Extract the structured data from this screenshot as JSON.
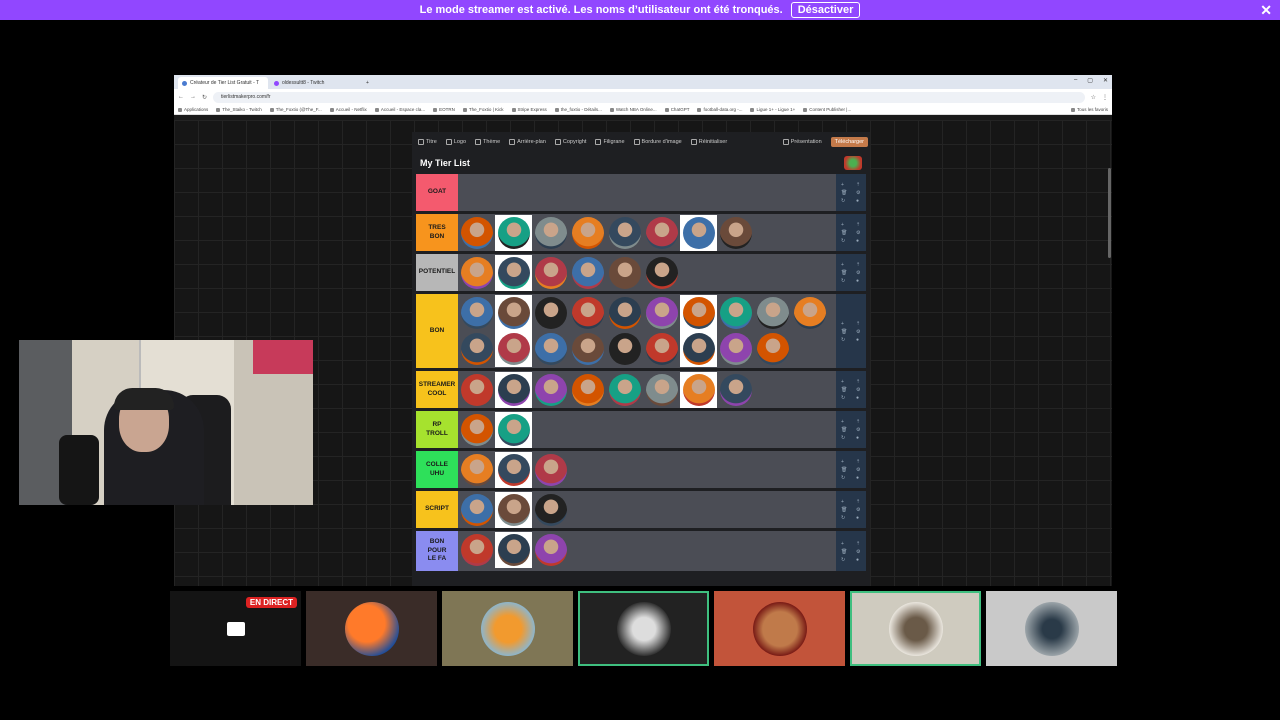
{
  "banner": {
    "text": "Le mode streamer est activé. Les noms d’utilisateur ont été tronqués.",
    "button": "Désactiver",
    "close": "✕"
  },
  "browser": {
    "tabs": [
      "Créateur de Tier List Gratuit - T",
      "oldessultt8 - Twitch"
    ],
    "new_tab": "+",
    "window_controls": [
      "–",
      "▢",
      "✕"
    ],
    "url": "tierlistmakerpro.com/fr",
    "bookmarks": [
      "Applications",
      "The_Staiko - Twitch",
      "The_Foxtio (@The_F...",
      "Accueil - Netflix",
      "Accueil - Espace cla...",
      "EOTRN",
      "The_Foxtio | Kick",
      "Stripe Express",
      "the_foxtio - Détails...",
      "Watch NBA Online...",
      "ChatGPT",
      "football-data.org -...",
      "Ligue 1+ - Ligue 1+",
      "Content Publisher |..."
    ],
    "bookmarks_right": "Tous les favoris"
  },
  "app": {
    "toolbar": [
      "Titre",
      "Logo",
      "Thème",
      "Arrière-plan",
      "Copyright",
      "Filigrane",
      "Bordure d'image",
      "Réinitialiser"
    ],
    "presentation": "Présentation",
    "download": "Télécharger",
    "title": "My Tier List",
    "tiers": [
      {
        "label": "GOAT",
        "color": "#f45a6e",
        "count": 0
      },
      {
        "label": "TRES\nBON",
        "color": "#f7941d",
        "count": 8
      },
      {
        "label": "POTENTIEL",
        "color": "#b7b7b7",
        "count": 6
      },
      {
        "label": "BON",
        "color": "#f7c21c",
        "count": 19
      },
      {
        "label": "STREAMER\nCOOL",
        "color": "#f7c21c",
        "count": 8
      },
      {
        "label": "RP\nTROLL",
        "color": "#a6e22e",
        "count": 2
      },
      {
        "label": "COLLE\nUHU",
        "color": "#2ee05a",
        "count": 3
      },
      {
        "label": "SCRIPT",
        "color": "#f7c21c",
        "count": 3
      },
      {
        "label": "BON\nPOUR\nLE FA",
        "color": "#8a8cf0",
        "count": 3
      }
    ]
  },
  "guests": {
    "live_badge": "EN DIRECT"
  }
}
